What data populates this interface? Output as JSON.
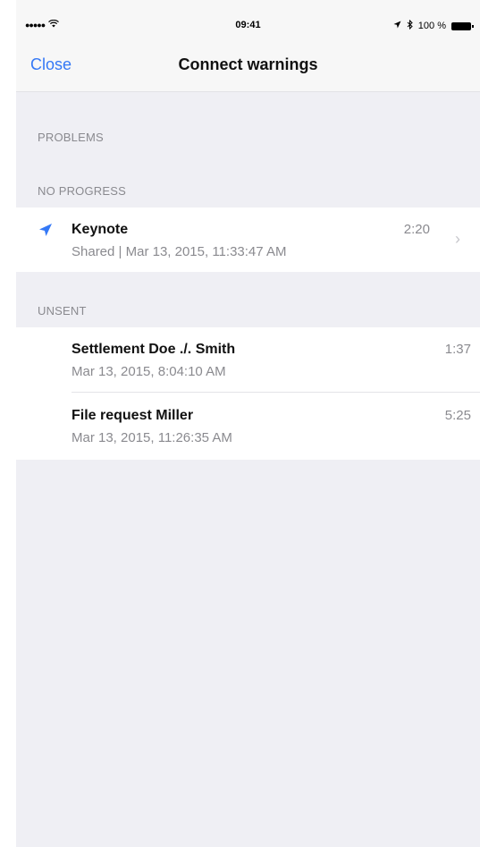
{
  "status_bar": {
    "signal": "●●●●●",
    "time": "09:41",
    "location_icon": "location-arrow-icon",
    "bluetooth_icon": "bluetooth-icon",
    "battery_text": "100 %"
  },
  "nav": {
    "close_label": "Close",
    "title": "Connect warnings"
  },
  "sections": {
    "problems_header": "PROBLEMS",
    "no_progress_header": "NO PROGRESS",
    "unsent_header": "UNSENT"
  },
  "no_progress": {
    "items": [
      {
        "icon": "send-arrow-icon",
        "title": "Keynote",
        "subtitle": "Shared | Mar 13, 2015, 11:33:47 AM",
        "time": "2:20",
        "chevron": "›"
      }
    ]
  },
  "unsent": {
    "items": [
      {
        "title": "Settlement Doe ./. Smith",
        "subtitle": "Mar 13, 2015, 8:04:10 AM",
        "time": "1:37"
      },
      {
        "title": "File request Miller",
        "subtitle": "Mar 13, 2015, 11:26:35 AM",
        "time": "5:25"
      }
    ]
  },
  "colors": {
    "accent": "#3478f6",
    "background": "#efeff4",
    "secondary_text": "#8a8a8f"
  }
}
